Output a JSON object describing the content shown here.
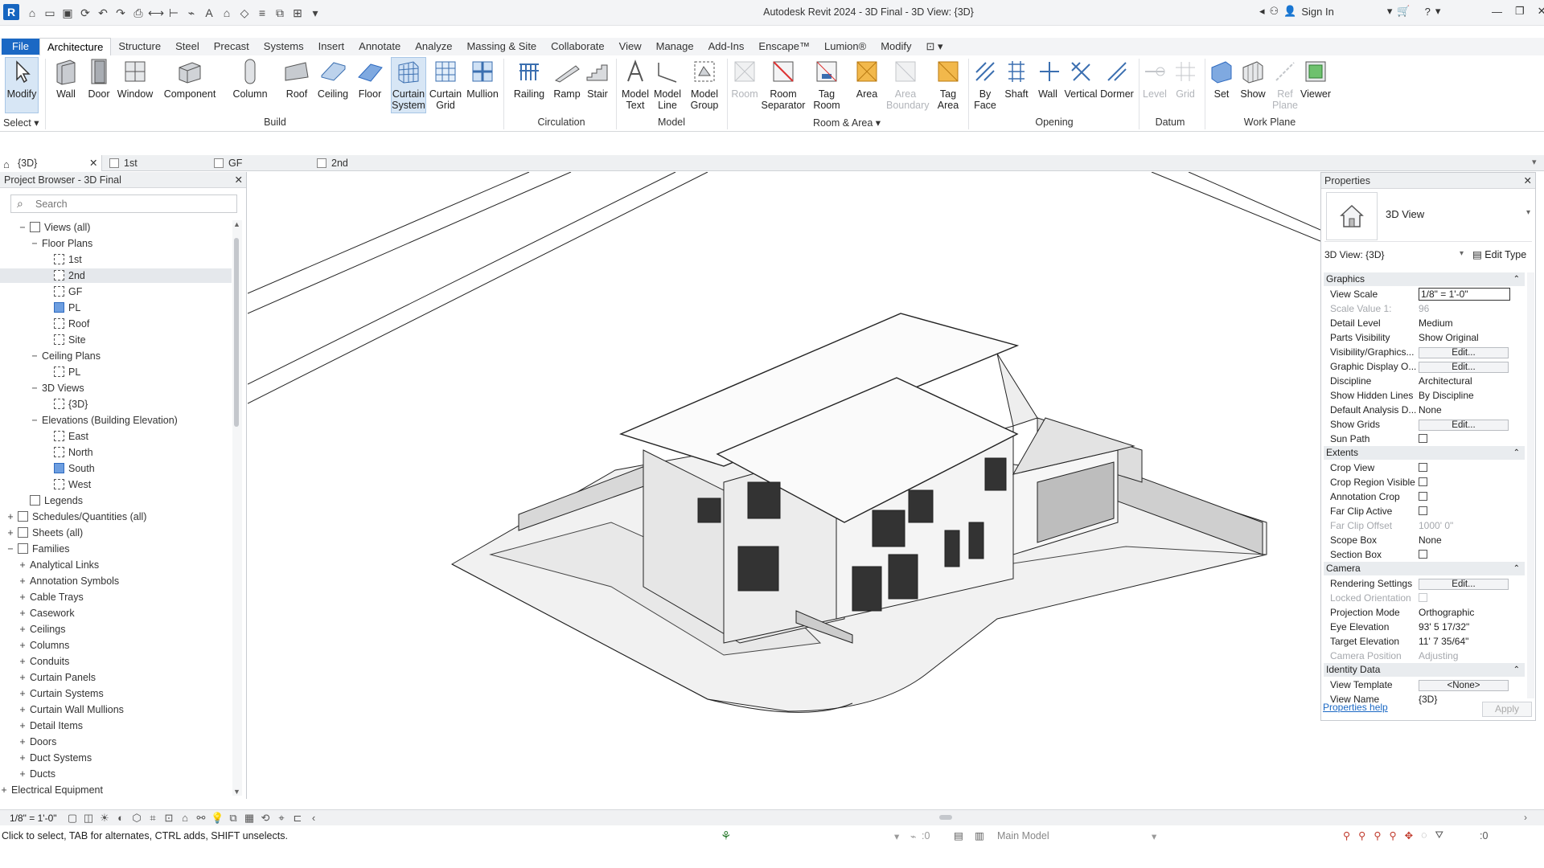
{
  "app": {
    "title": "Autodesk Revit 2024 - 3D Final - 3D View: {3D}",
    "logo": "R",
    "sign_in": "Sign In"
  },
  "menu": {
    "file": "File",
    "tabs": [
      "Architecture",
      "Structure",
      "Steel",
      "Precast",
      "Systems",
      "Insert",
      "Annotate",
      "Analyze",
      "Massing & Site",
      "Collaborate",
      "View",
      "Manage",
      "Add-Ins",
      "Enscape™",
      "Lumion®",
      "Modify"
    ]
  },
  "ribbon": {
    "modify": "Modify",
    "select": "Select",
    "build": [
      "Wall",
      "Door",
      "Window",
      "Component",
      "Column",
      "Roof",
      "Ceiling",
      "Floor"
    ],
    "curtain_system": [
      "Curtain",
      "System"
    ],
    "curtain_grid": [
      "Curtain",
      "Grid"
    ],
    "mullion": "Mullion",
    "build_label": "Build",
    "circulation": [
      "Railing",
      "Ramp",
      "Stair"
    ],
    "circulation_label": "Circulation",
    "model_text": [
      "Model",
      "Text"
    ],
    "model_line": [
      "Model",
      "Line"
    ],
    "model_group": [
      "Model",
      "Group"
    ],
    "model_label": "Model",
    "room": "Room",
    "room_separator": [
      "Room",
      "Separator"
    ],
    "tag_room": [
      "Tag",
      "Room"
    ],
    "area": "Area",
    "area_boundary": [
      "Area",
      "Boundary"
    ],
    "tag_area": [
      "Tag",
      "Area"
    ],
    "room_area_label": "Room & Area",
    "by_face": [
      "By",
      "Face"
    ],
    "shaft": "Shaft",
    "wall_op": "Wall",
    "vertical": "Vertical",
    "dormer": "Dormer",
    "opening_label": "Opening",
    "level": "Level",
    "grid": "Grid",
    "datum_label": "Datum",
    "set": "Set",
    "show": "Show",
    "ref_plane": [
      "Ref",
      "Plane"
    ],
    "viewer": "Viewer",
    "work_plane_label": "Work Plane"
  },
  "view_tabs": [
    "{3D}",
    "1st",
    "GF",
    "2nd"
  ],
  "browser": {
    "title": "Project Browser - 3D Final",
    "search_placeholder": "Search",
    "items": [
      {
        "label": "Views (all)",
        "toggle": "−",
        "icon": "views"
      },
      {
        "label": "Floor Plans",
        "toggle": "−"
      },
      {
        "label": "1st",
        "icon": "view"
      },
      {
        "label": "2nd",
        "icon": "view"
      },
      {
        "label": "GF",
        "icon": "view"
      },
      {
        "label": "PL",
        "icon": "view-blue"
      },
      {
        "label": "Roof",
        "icon": "view"
      },
      {
        "label": "Site",
        "icon": "view"
      },
      {
        "label": "Ceiling Plans",
        "toggle": "−"
      },
      {
        "label": "PL",
        "icon": "view"
      },
      {
        "label": "3D Views",
        "toggle": "−"
      },
      {
        "label": "{3D}",
        "icon": "view",
        "bold": true
      },
      {
        "label": "Elevations (Building Elevation)",
        "toggle": "−"
      },
      {
        "label": "East",
        "icon": "view"
      },
      {
        "label": "North",
        "icon": "view"
      },
      {
        "label": "South",
        "icon": "view-blue"
      },
      {
        "label": "West",
        "icon": "view"
      },
      {
        "label": "Legends",
        "icon": "legends"
      },
      {
        "label": "Schedules/Quantities (all)",
        "toggle": "+",
        "icon": "schedules"
      },
      {
        "label": "Sheets (all)",
        "toggle": "+",
        "icon": "sheets"
      },
      {
        "label": "Families",
        "toggle": "−",
        "icon": "families"
      },
      {
        "label": "Analytical Links",
        "toggle": "+"
      },
      {
        "label": "Annotation Symbols",
        "toggle": "+"
      },
      {
        "label": "Cable Trays",
        "toggle": "+"
      },
      {
        "label": "Casework",
        "toggle": "+"
      },
      {
        "label": "Ceilings",
        "toggle": "+"
      },
      {
        "label": "Columns",
        "toggle": "+"
      },
      {
        "label": "Conduits",
        "toggle": "+"
      },
      {
        "label": "Curtain Panels",
        "toggle": "+"
      },
      {
        "label": "Curtain Systems",
        "toggle": "+"
      },
      {
        "label": "Curtain Wall Mullions",
        "toggle": "+"
      },
      {
        "label": "Detail Items",
        "toggle": "+"
      },
      {
        "label": "Doors",
        "toggle": "+"
      },
      {
        "label": "Duct Systems",
        "toggle": "+"
      },
      {
        "label": "Ducts",
        "toggle": "+"
      },
      {
        "label": "Electrical Equipment",
        "toggle": "+"
      }
    ]
  },
  "properties": {
    "title": "Properties",
    "type_name": "3D View",
    "selector": "3D View: {3D}",
    "edit_type": "Edit Type",
    "groups": {
      "graphics": "Graphics",
      "extents": "Extents",
      "camera": "Camera",
      "identity": "Identity Data"
    },
    "rows": {
      "view_scale": [
        "View Scale",
        "1/8\" = 1'-0\""
      ],
      "scale_value": [
        "Scale Value    1:",
        "96"
      ],
      "detail_level": [
        "Detail Level",
        "Medium"
      ],
      "parts_visibility": [
        "Parts Visibility",
        "Show Original"
      ],
      "vis_graphics": [
        "Visibility/Graphics...",
        "Edit..."
      ],
      "graphic_display": [
        "Graphic Display O...",
        "Edit..."
      ],
      "discipline": [
        "Discipline",
        "Architectural"
      ],
      "hidden_lines": [
        "Show Hidden Lines",
        "By Discipline"
      ],
      "default_analysis": [
        "Default Analysis D...",
        "None"
      ],
      "show_grids": [
        "Show Grids",
        "Edit..."
      ],
      "sun_path": [
        "Sun Path",
        ""
      ],
      "crop_view": [
        "Crop View",
        ""
      ],
      "crop_region": [
        "Crop Region Visible",
        ""
      ],
      "annotation_crop": [
        "Annotation Crop",
        ""
      ],
      "far_clip_active": [
        "Far Clip Active",
        ""
      ],
      "far_clip_offset": [
        "Far Clip Offset",
        "1000'  0\""
      ],
      "scope_box": [
        "Scope Box",
        "None"
      ],
      "section_box": [
        "Section Box",
        ""
      ],
      "rendering": [
        "Rendering Settings",
        "Edit..."
      ],
      "locked_orientation": [
        "Locked Orientation",
        ""
      ],
      "projection": [
        "Projection Mode",
        "Orthographic"
      ],
      "eye_elevation": [
        "Eye Elevation",
        "93'  5 17/32\""
      ],
      "target_elevation": [
        "Target Elevation",
        "11'  7 35/64\""
      ],
      "camera_position": [
        "Camera Position",
        "Adjusting"
      ],
      "view_template": [
        "View Template",
        "<None>"
      ],
      "view_name": [
        "View Name",
        "{3D}"
      ]
    },
    "help": "Properties help",
    "apply": "Apply"
  },
  "status": {
    "scale": "1/8\" = 1'-0\"",
    "message": "Click to select, TAB for alternates, CTRL adds, SHIFT unselects.",
    "workset": "Main Model",
    "coord": ":0",
    "filter": ":0"
  }
}
